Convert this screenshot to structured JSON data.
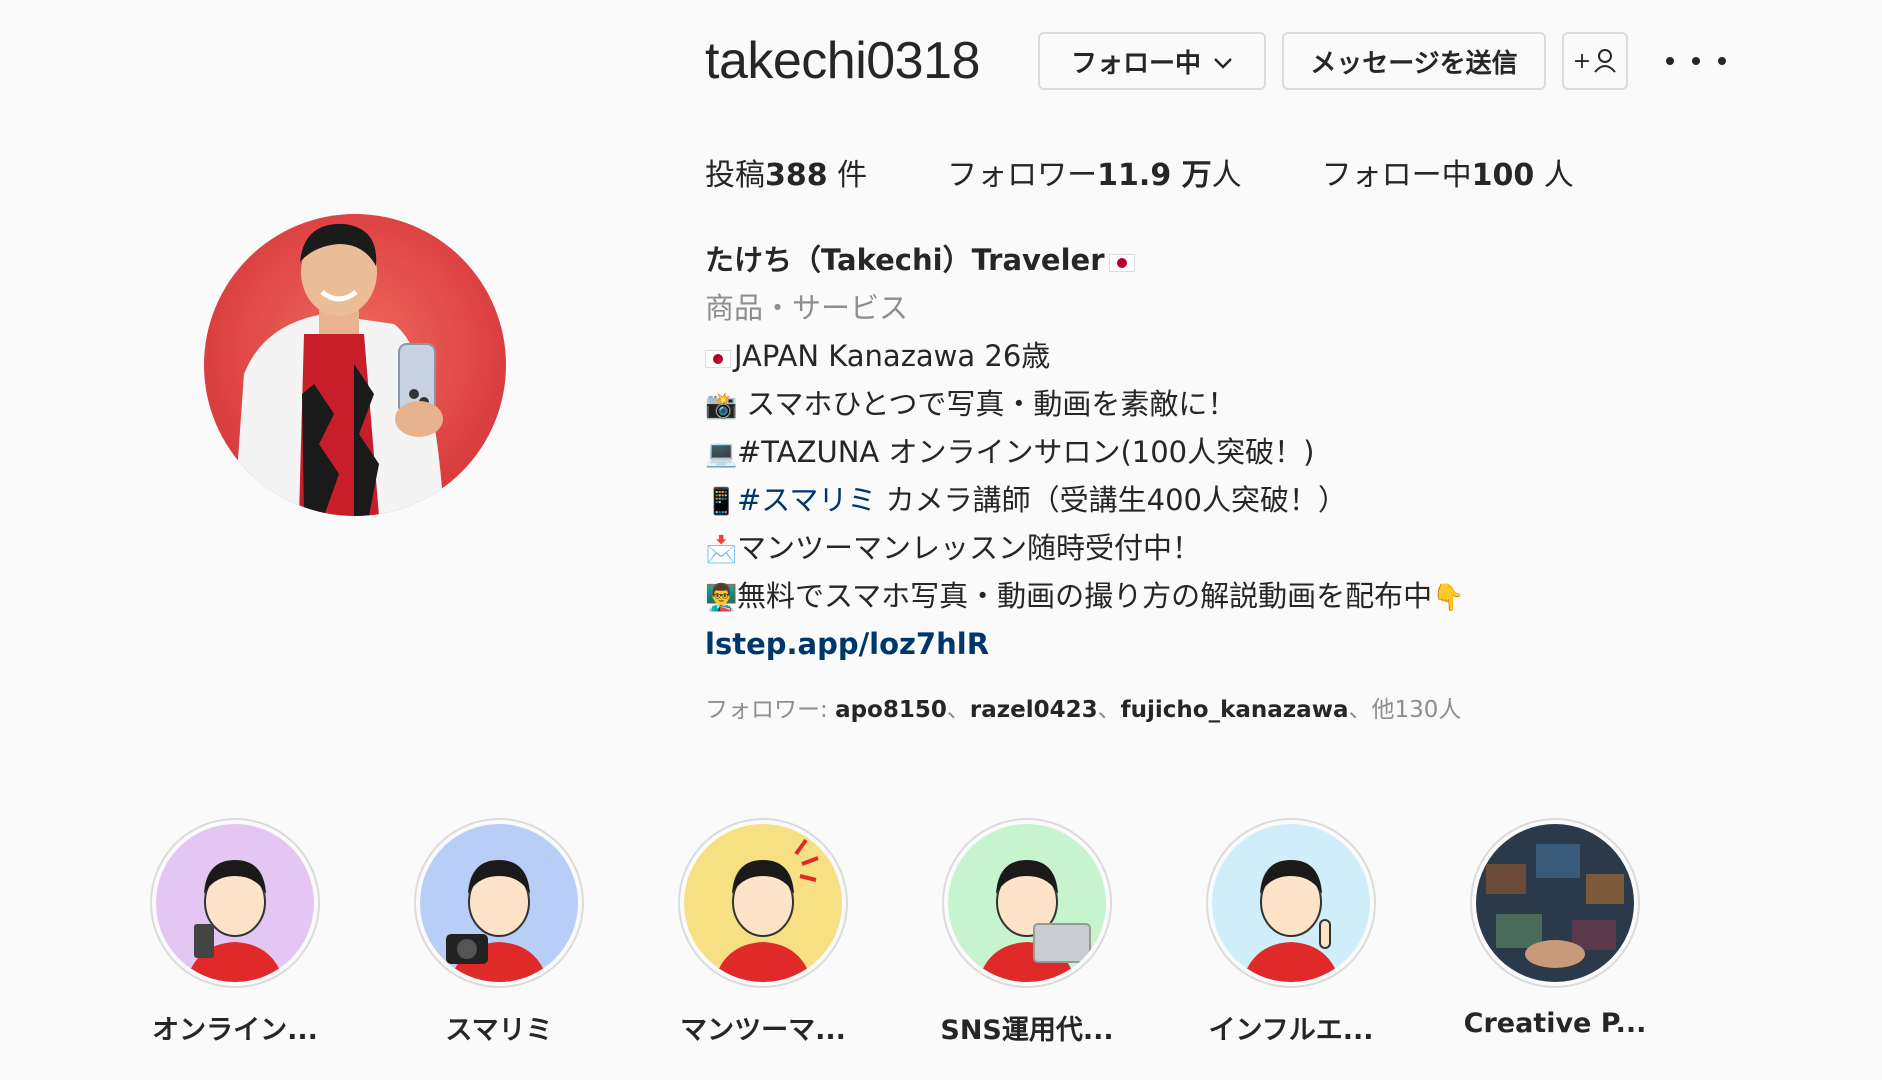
{
  "profile": {
    "username": "takechi0318",
    "following_button": "フォロー中",
    "message_button": "メッセージを送信",
    "add_user_symbol": "+"
  },
  "stats": {
    "posts_label": "投稿",
    "posts_count": "388",
    "posts_suffix": " 件",
    "followers_label": "フォロワー",
    "followers_count": "11.9 万",
    "followers_suffix": "人",
    "following_label": "フォロー中",
    "following_count": "100",
    "following_suffix": " 人"
  },
  "bio": {
    "name": "たけち（Takechi）Traveler",
    "category": "商品・サービス",
    "line1": "JAPAN Kanazawa 26歳",
    "line2": "スマホひとつで写真・動画を素敵に！",
    "line3": "#TAZUNA オンラインサロン(100人突破！)",
    "line4_tag": "#スマリミ",
    "line4_rest": " カメラ講師（受講生400人突破！）",
    "line5": "マンツーマンレッスン随時受付中！",
    "line6": "無料でスマホ写真・動画の撮り方の解説動画を配布中",
    "emoji_camera": "📸",
    "emoji_laptop": "💻",
    "emoji_phone": "📱",
    "emoji_mail": "📩",
    "emoji_teacher": "👨‍🏫",
    "emoji_point": "👇",
    "link": "lstep.app/loz7hlR"
  },
  "followed_by": {
    "prefix": "フォロワー: ",
    "user1": "apo8150",
    "sep1": "、",
    "user2": "razel0423",
    "sep2": "、",
    "user3": "fujicho_kanazawa",
    "suffix": "、他130人"
  },
  "highlights": [
    {
      "label": "オンライン...",
      "bg": "#e4c6f2"
    },
    {
      "label": "スマリミ",
      "bg": "#b8cef7"
    },
    {
      "label": "マンツーマ...",
      "bg": "#f7e084"
    },
    {
      "label": "SNS運用代...",
      "bg": "#c6f4cf"
    },
    {
      "label": "インフルエ...",
      "bg": "#cfeefa"
    },
    {
      "label": "Creative P...",
      "bg": "#2a3a4a"
    }
  ],
  "colors": {
    "avatar_bg": "#e24a4a",
    "link": "#00376b",
    "muted": "#8e8e8e"
  }
}
